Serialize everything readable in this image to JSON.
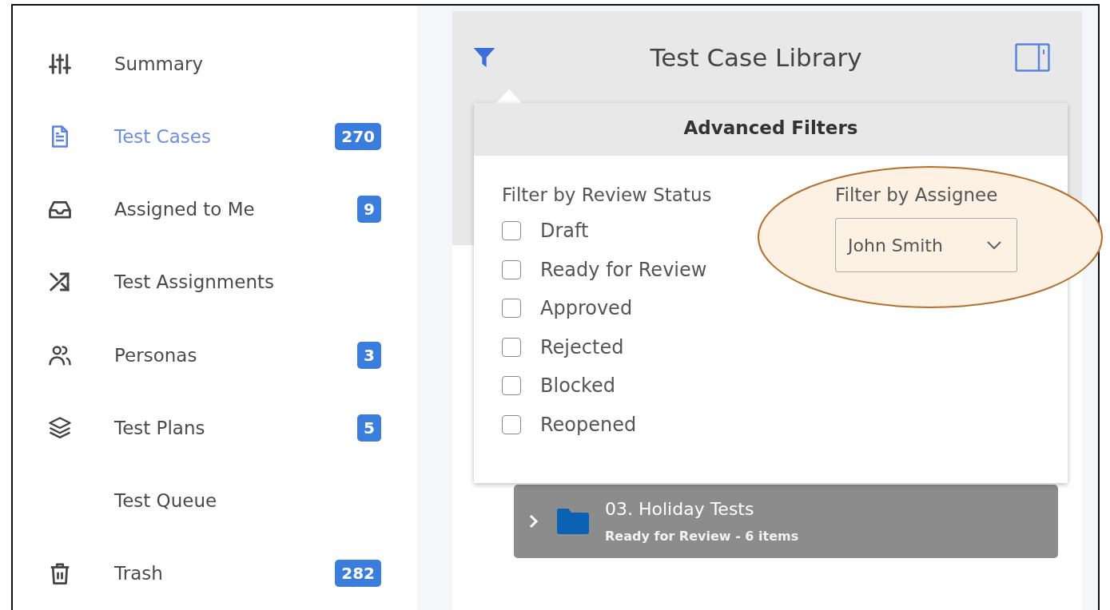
{
  "sidebar": {
    "items": [
      {
        "label": "Summary",
        "selected": false
      },
      {
        "label": "Test Cases",
        "badge": "270",
        "selected": true
      },
      {
        "label": "Assigned to Me",
        "badge": "9",
        "selected": false
      },
      {
        "label": "Test Assignments",
        "selected": false
      },
      {
        "label": "Personas",
        "badge": "3",
        "selected": false
      },
      {
        "label": "Test Plans",
        "badge": "5",
        "selected": false
      },
      {
        "label": "Test Queue",
        "selected": false
      },
      {
        "label": "Trash",
        "badge": "282",
        "selected": false
      }
    ]
  },
  "library": {
    "title": "Test Case Library",
    "filters": {
      "title": "Advanced Filters",
      "status": {
        "label": "Filter by Review Status",
        "options": [
          {
            "label": "Draft",
            "checked": false
          },
          {
            "label": "Ready for Review",
            "checked": false
          },
          {
            "label": "Approved",
            "checked": false
          },
          {
            "label": "Rejected",
            "checked": false
          },
          {
            "label": "Blocked",
            "checked": false
          },
          {
            "label": "Reopened",
            "checked": false
          }
        ]
      },
      "assignee": {
        "label": "Filter by Assignee",
        "value": "John Smith"
      }
    },
    "tree": {
      "rows": [
        {
          "title": "03. Holiday Tests",
          "subtitle": "Ready for Review - 6 items",
          "expanded": false
        }
      ]
    }
  }
}
